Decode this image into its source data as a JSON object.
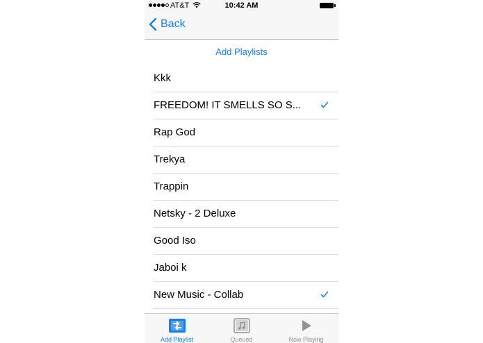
{
  "status_bar": {
    "carrier": "AT&T",
    "time": "10:42 AM",
    "signal_bars_filled": 4,
    "signal_bars_total": 5
  },
  "nav": {
    "back_label": "Back"
  },
  "section_title": "Add Playlists",
  "playlists": [
    {
      "label": "Kkk",
      "selected": false
    },
    {
      "label": "FREEDOM! IT SMELLS SO S...",
      "selected": true
    },
    {
      "label": "Rap God",
      "selected": false
    },
    {
      "label": "Trekya",
      "selected": false
    },
    {
      "label": "Trappin",
      "selected": false
    },
    {
      "label": "Netsky - 2 Deluxe",
      "selected": false
    },
    {
      "label": "Good Iso",
      "selected": false
    },
    {
      "label": "Jaboi k",
      "selected": false
    },
    {
      "label": "New Music - Collab",
      "selected": true
    }
  ],
  "tabs": [
    {
      "label": "Add Playlist",
      "icon": "add-playlist-icon",
      "active": true
    },
    {
      "label": "Queued",
      "icon": "queued-music-icon",
      "active": false
    },
    {
      "label": "Now Playing",
      "icon": "play-icon",
      "active": false
    }
  ],
  "colors": {
    "accent": "#1a7fe0",
    "inactive": "#929292",
    "bar_background": "#f7f7f7"
  }
}
